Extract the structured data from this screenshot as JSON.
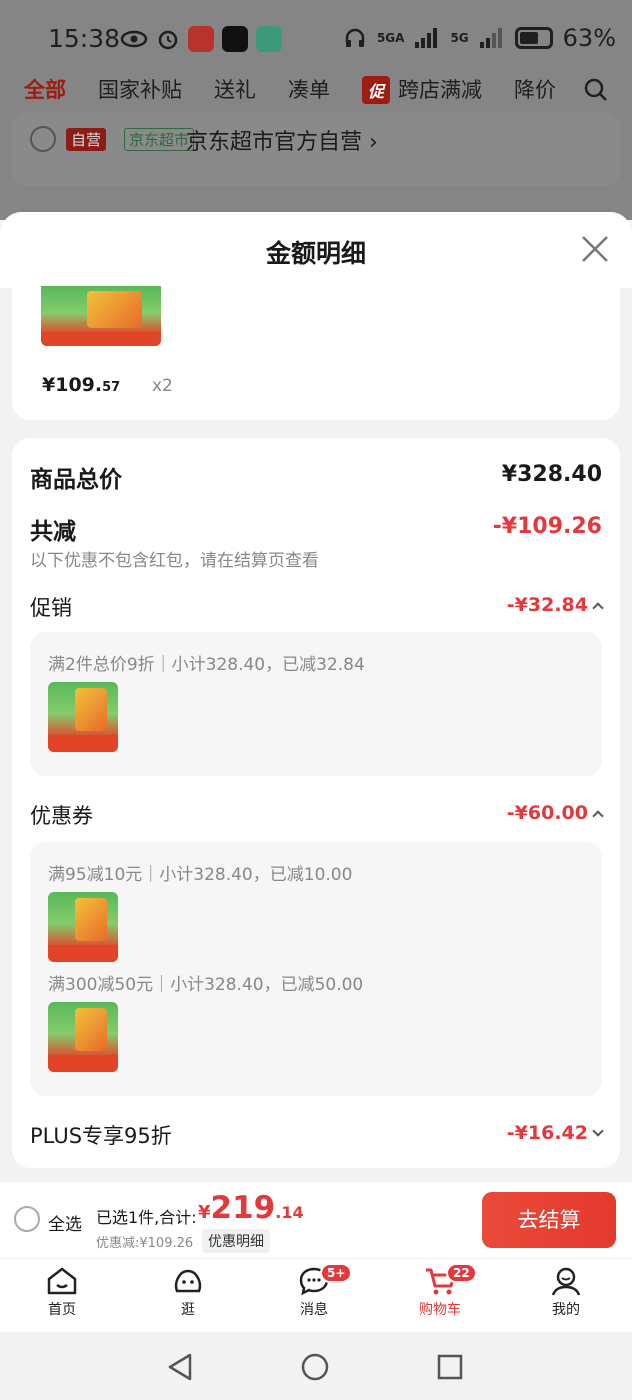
{
  "status_bar": {
    "time": "15:38",
    "network1": "5GA",
    "network2": "5G",
    "battery": "63%"
  },
  "tabs": [
    "全部",
    "国家补贴",
    "送礼",
    "凑单",
    "跨店满减",
    "降价"
  ],
  "promo_badge": "促",
  "store": {
    "tag_self": "自营",
    "tag_jd": "京东超市",
    "name": "京东超市官方自营"
  },
  "modal": {
    "title": "金额明细",
    "product": {
      "price_main": "¥109.",
      "price_dec": "57",
      "qty": "x2"
    },
    "total_label": "商品总价",
    "total_value": "¥328.40",
    "reduce_label": "共减",
    "reduce_value": "-¥109.26",
    "reduce_note": "以下优惠不包含红包，请在结算页查看",
    "promo_label": "促销",
    "promo_value": "-¥32.84",
    "promo_line": "满2件总价9折｜小计328.40，已减32.84",
    "coupon_label": "优惠券",
    "coupon_value": "-¥60.00",
    "coupon_line1": "满95减10元｜小计328.40，已减10.00",
    "coupon_line2": "满300减50元｜小计328.40，已减50.00",
    "plus_label": "PLUS专享95折",
    "plus_value": "-¥16.42"
  },
  "checkout": {
    "select_all": "全选",
    "selected": "已选1件,合计:",
    "cur": "¥",
    "int": "219",
    "dec": ".14",
    "discount": "优惠减:¥109.26",
    "detail": "优惠明细",
    "go": "去结算"
  },
  "nav": {
    "home": "首页",
    "browse": "逛",
    "msg": "消息",
    "msg_badge": "5+",
    "cart": "购物车",
    "cart_badge": "22",
    "me": "我的"
  },
  "colors": {
    "accent": "#e4393c"
  }
}
